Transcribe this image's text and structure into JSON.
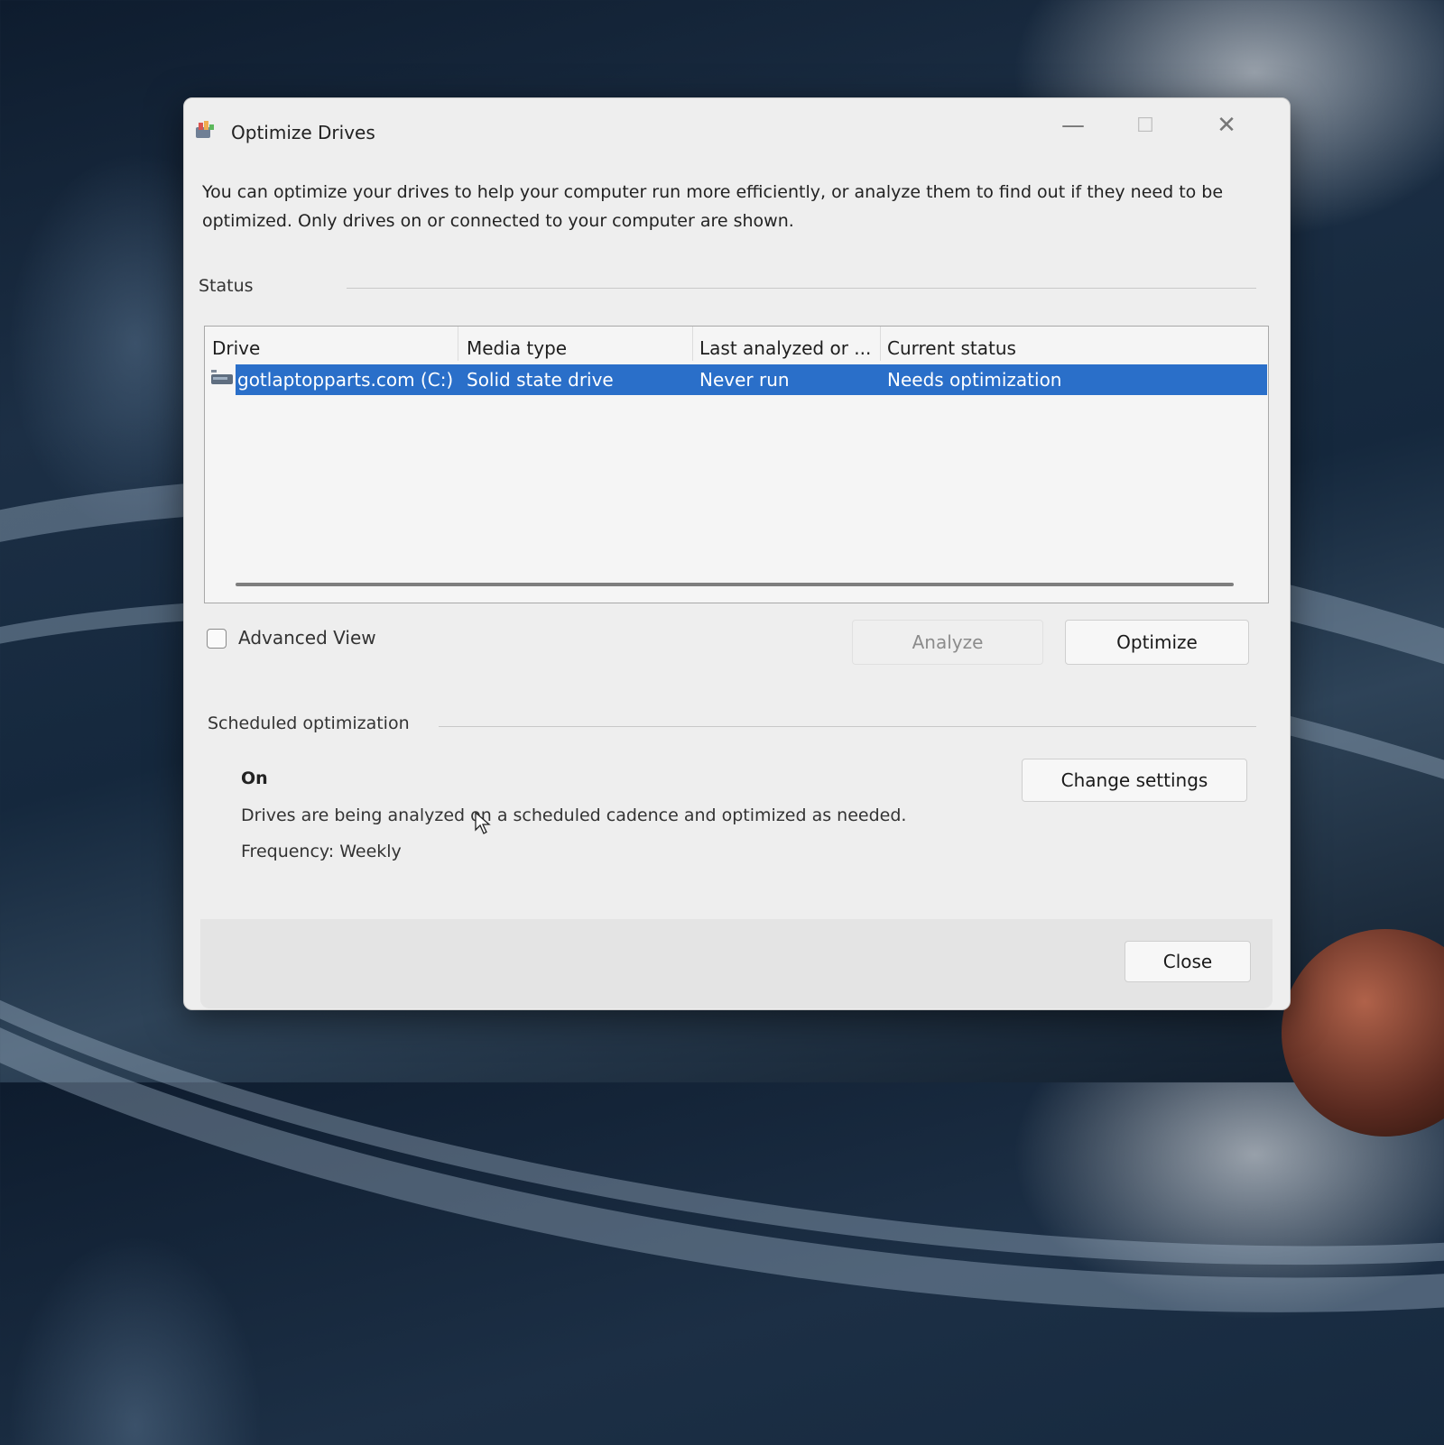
{
  "window": {
    "title": "Optimize Drives",
    "controls": {
      "minimize": "—",
      "maximize": "☐",
      "close": "✕"
    }
  },
  "intro_text": "You can optimize your drives to help your computer run more efficiently, or analyze them to find out if they need to be optimized. Only drives on or connected to your computer are shown.",
  "status_section": {
    "label": "Status",
    "columns": [
      "Drive",
      "Media type",
      "Last analyzed or ...",
      "Current status"
    ],
    "rows": [
      {
        "drive": "gotlaptopparts.com (C:)",
        "media_type": "Solid state drive",
        "last_analyzed": "Never run",
        "current_status": "Needs optimization",
        "selected": true
      }
    ]
  },
  "advanced_view": {
    "label": "Advanced View",
    "checked": false
  },
  "buttons": {
    "analyze": "Analyze",
    "optimize": "Optimize",
    "change_settings": "Change settings",
    "close": "Close"
  },
  "scheduled_section": {
    "label": "Scheduled optimization",
    "state": "On",
    "description": "Drives are being analyzed on a scheduled cadence and optimized as needed.",
    "frequency": "Frequency: Weekly"
  },
  "colors": {
    "selection": "#2a6fc9",
    "window_bg": "#eeeeee",
    "footer_bg": "#e4e4e4"
  }
}
